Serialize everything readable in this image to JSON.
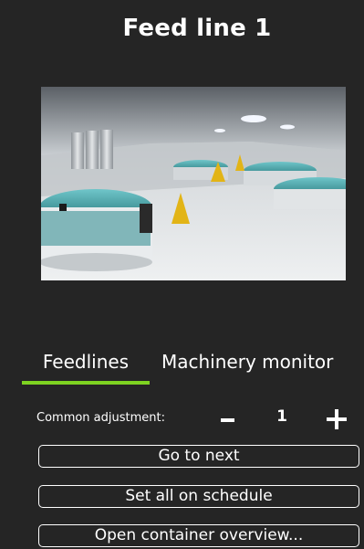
{
  "header": {
    "title": "Feed line 1"
  },
  "hero": {
    "alt": "Fish farm hall with circular tanks and feed silos"
  },
  "tabs": [
    {
      "label": "Feedlines",
      "active": true
    },
    {
      "label": "Machinery monitor",
      "active": false
    }
  ],
  "controls": {
    "common_label": "Common adjustment:",
    "value": "1"
  },
  "buttons": {
    "next": "Go to next",
    "schedule": "Set all on schedule",
    "overview": "Open container overview..."
  },
  "colors": {
    "background": "#252525",
    "accent": "#7ed321",
    "text": "#ffffff"
  }
}
